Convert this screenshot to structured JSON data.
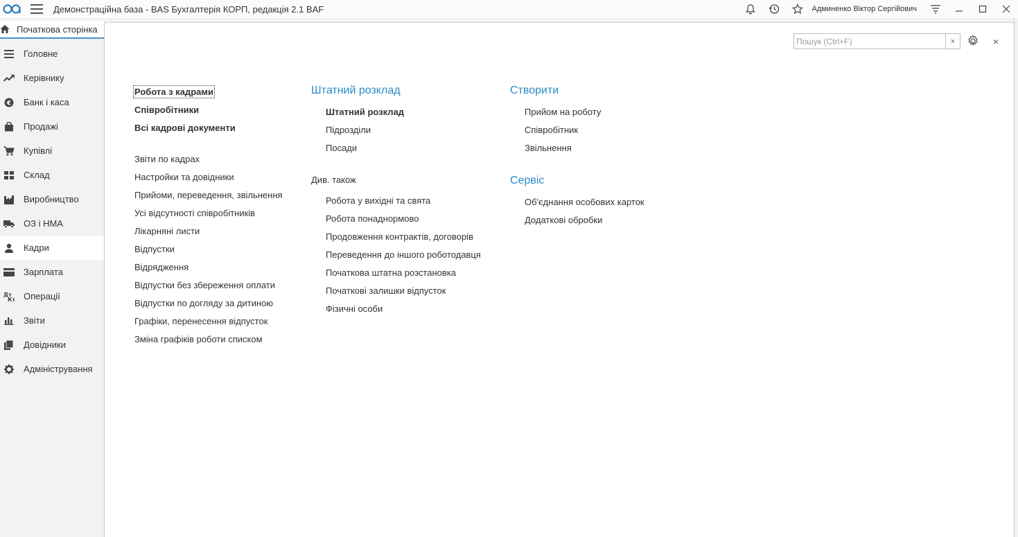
{
  "titlebar": {
    "app_title": "Демонстраційна база - BAS Бухгалтерія КОРП, редакція 2.1 BAF",
    "user_name": "Админенко Віктор Сергійович"
  },
  "start_tab": {
    "label": "Початкова сторінка"
  },
  "sidebar": {
    "items": [
      {
        "label": "Головне",
        "icon": "menu-lines-icon"
      },
      {
        "label": "Керівнику",
        "icon": "trend-chart-icon"
      },
      {
        "label": "Банк і каса",
        "icon": "coin-icon"
      },
      {
        "label": "Продажі",
        "icon": "bag-icon"
      },
      {
        "label": "Купівлі",
        "icon": "cart-icon"
      },
      {
        "label": "Склад",
        "icon": "warehouse-icon"
      },
      {
        "label": "Виробництво",
        "icon": "factory-icon"
      },
      {
        "label": "ОЗ і НМА",
        "icon": "truck-icon"
      },
      {
        "label": "Кадри",
        "icon": "person-icon",
        "active": true
      },
      {
        "label": "Зарплата",
        "icon": "card-icon"
      },
      {
        "label": "Операції",
        "icon": "dt-kt-icon"
      },
      {
        "label": "Звіти",
        "icon": "bar-chart-icon"
      },
      {
        "label": "Довідники",
        "icon": "books-icon"
      },
      {
        "label": "Адміністрування",
        "icon": "gear-icon"
      }
    ]
  },
  "search": {
    "placeholder": "Пошук (Ctrl+F)",
    "clear_label": "×"
  },
  "close_label": "×",
  "col1": {
    "bold_links": [
      "Робота з кадрами",
      "Співробітники",
      "Всі кадрові документи"
    ],
    "links": [
      "Звіти по кадрах",
      "Настройки та довідники",
      "Прийоми, переведення, звільнення",
      "Усі відсутності співробітників",
      "Лікарняні листи",
      "Відпустки",
      "Відрядження",
      "Відпустки без збереження оплати",
      "Відпустки по догляду за дитиною",
      "Графіки, перенесення відпусток",
      "Зміна графіків роботи списком"
    ]
  },
  "col2": {
    "title": "Штатний розклад",
    "bold_link": "Штатний розклад",
    "links": [
      "Підрозділи",
      "Посади"
    ],
    "see_also_label": "Див. також",
    "see_also_links": [
      "Робота у вихідні та свята",
      "Робота понаднормово",
      "Продовження контрактів, договорів",
      "Переведення до іншого роботодавця",
      "Початкова штатна розстановка",
      "Початкові залишки відпусток",
      "Фізичні особи"
    ]
  },
  "col3": {
    "create_title": "Створити",
    "create_links": [
      "Прийом на роботу",
      "Співробітник",
      "Звільнення"
    ],
    "service_title": "Сервіс",
    "service_links": [
      "Об'єднання особових карток",
      "Додаткові обробки"
    ]
  },
  "colors": {
    "accent": "#2a8cc7",
    "tab_underline": "#4a90c8"
  }
}
